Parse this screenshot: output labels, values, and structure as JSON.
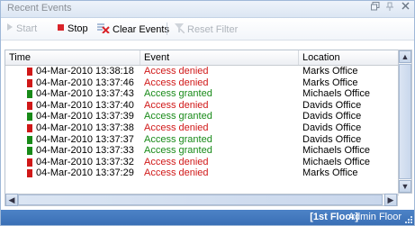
{
  "window": {
    "title": "Recent Events",
    "pin_icon": "pin-icon",
    "float_icon": "float-icon",
    "close_icon": "close-icon"
  },
  "toolbar": {
    "start_label": "Start",
    "stop_label": "Stop",
    "clear_label": "Clear Events",
    "reset_label": "Reset Filter"
  },
  "columns": {
    "time": "Time",
    "event": "Event",
    "location": "Location"
  },
  "colors": {
    "denied": "#d01818",
    "granted": "#188a18",
    "status_bar": "#3f76bd"
  },
  "rows": [
    {
      "time": "04-Mar-2010 13:38:18",
      "event": "Access denied",
      "location": "Marks Office",
      "status": "denied"
    },
    {
      "time": "04-Mar-2010 13:37:46",
      "event": "Access denied",
      "location": "Marks Office",
      "status": "denied"
    },
    {
      "time": "04-Mar-2010 13:37:43",
      "event": "Access granted",
      "location": "Michaels Office",
      "status": "granted"
    },
    {
      "time": "04-Mar-2010 13:37:40",
      "event": "Access denied",
      "location": "Davids Office",
      "status": "denied"
    },
    {
      "time": "04-Mar-2010 13:37:39",
      "event": "Access granted",
      "location": "Davids Office",
      "status": "granted"
    },
    {
      "time": "04-Mar-2010 13:37:38",
      "event": "Access denied",
      "location": "Davids Office",
      "status": "denied"
    },
    {
      "time": "04-Mar-2010 13:37:37",
      "event": "Access granted",
      "location": "Davids Office",
      "status": "granted"
    },
    {
      "time": "04-Mar-2010 13:37:33",
      "event": "Access granted",
      "location": "Michaels Office",
      "status": "granted"
    },
    {
      "time": "04-Mar-2010 13:37:32",
      "event": "Access denied",
      "location": "Michaels Office",
      "status": "denied"
    },
    {
      "time": "04-Mar-2010 13:37:29",
      "event": "Access denied",
      "location": "Marks Office",
      "status": "denied"
    }
  ],
  "statusbar": {
    "floor": "[1st Floor]",
    "place": "Admin Floor"
  }
}
